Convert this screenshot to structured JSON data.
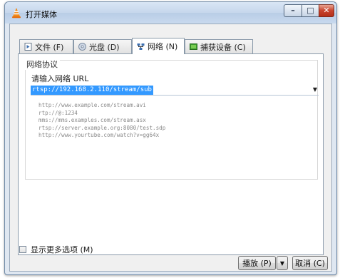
{
  "window": {
    "title": "打开媒体"
  },
  "titlebar_buttons": {
    "minimize": "–",
    "maximize": "□",
    "close": "✕"
  },
  "tabs": [
    {
      "label": "文件 (F)",
      "icon": "file-icon"
    },
    {
      "label": "光盘 (D)",
      "icon": "disc-icon"
    },
    {
      "label": "网络 (N)",
      "icon": "network-icon"
    },
    {
      "label": "捕获设备 (C)",
      "icon": "capture-device-icon"
    }
  ],
  "active_tab": "网络 (N)",
  "network": {
    "group_label": "网络协议",
    "url_label": "请输入网络 URL",
    "url_value": "rtsp://192.168.2.110/stream/sub",
    "examples": [
      "http://www.example.com/stream.avi",
      "rtp://@:1234",
      "mms://mms.examples.com/stream.asx",
      "rtsp://server.example.org:8080/test.sdp",
      "http://www.yourtube.com/watch?v=gg64x"
    ]
  },
  "options": {
    "show_more_label": "显示更多选项 (M)",
    "checked": false
  },
  "footer": {
    "play_label": "播放 (P)",
    "dropdown_arrow": "▼",
    "cancel_label": "取消 (C)"
  }
}
